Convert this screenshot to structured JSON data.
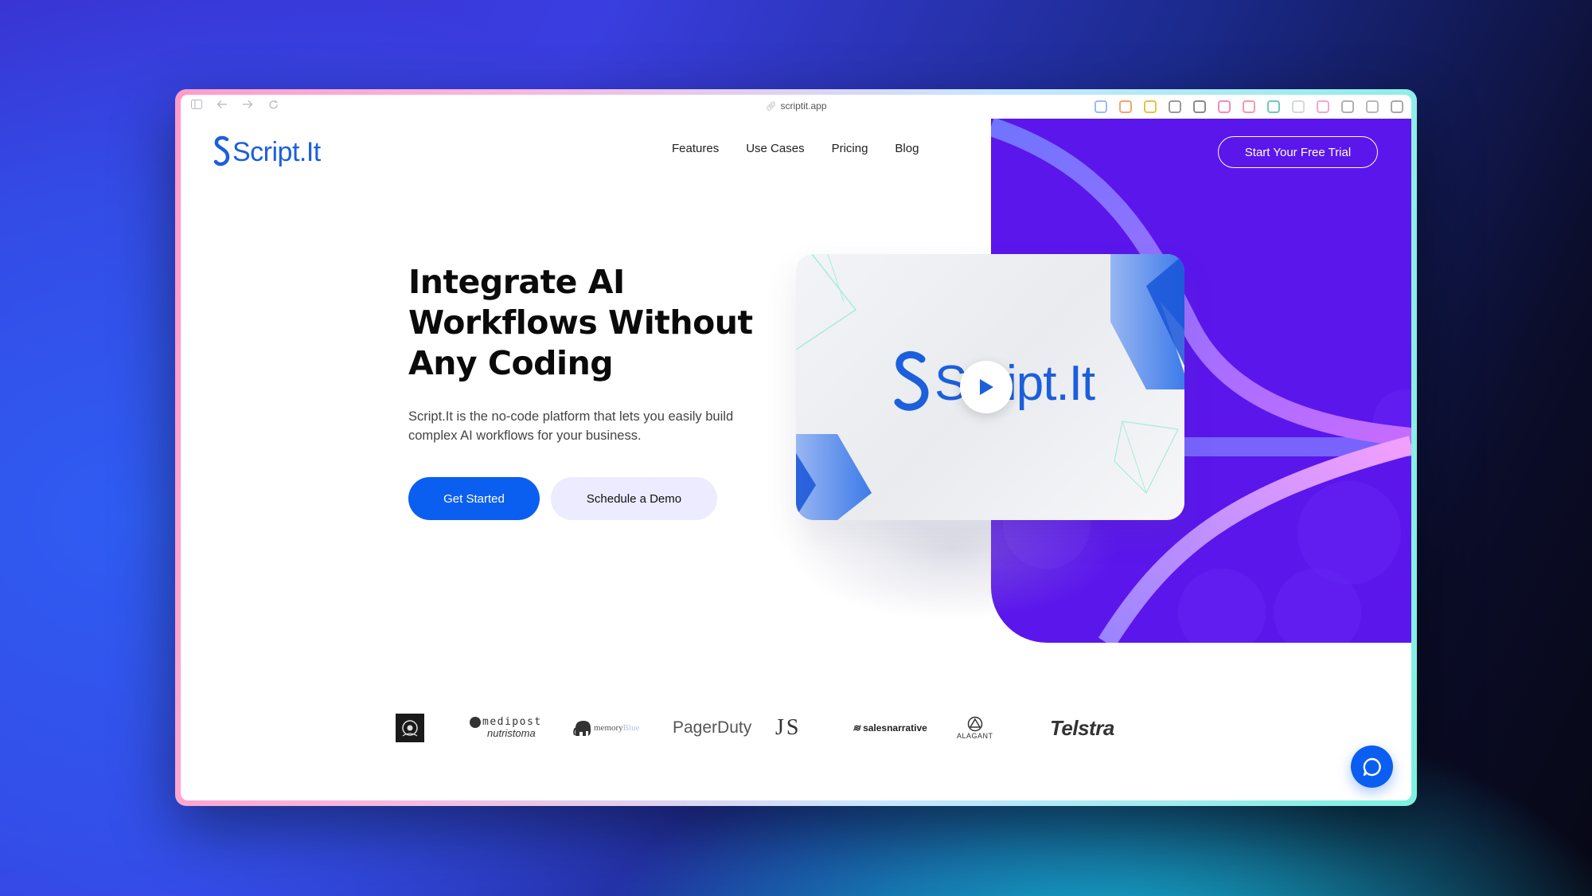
{
  "browser": {
    "url": "scriptit.app",
    "left_icons": [
      "sidebar-toggle-icon",
      "back-arrow-icon",
      "forward-arrow-icon",
      "reload-icon"
    ],
    "extension_colors": [
      "#9fb9f5",
      "#f5a56b",
      "#e2c24a",
      "#9a9a9a",
      "#8a8a8a",
      "#f28db5",
      "#f49aa8",
      "#6fc9c0",
      "#d8d8d8",
      "#f1a6cf",
      "#b0b0b0",
      "#b8b8b8",
      "#a8a8a8"
    ]
  },
  "site": {
    "logo": "Script.It",
    "nav": [
      "Features",
      "Use Cases",
      "Pricing",
      "Blog"
    ],
    "cta_top": "Start Your Free Trial"
  },
  "hero": {
    "title": "Integrate AI Workflows Without Any Coding",
    "subtitle": "Script.It is the no-code platform that lets you easily build complex AI workflows for your business.",
    "primary_button": "Get Started",
    "secondary_button": "Schedule a Demo"
  },
  "video": {
    "logo": "Script.It"
  },
  "brands": {
    "medipost_top": "medipost",
    "medipost_bottom": "nutristoma",
    "memoryblue_a": "memory",
    "memoryblue_b": "Blue",
    "pagerduty": "PagerDuty",
    "js": "J S",
    "salesnarrative": "salesnarrative",
    "alagant": "ALAGANT",
    "telstra": "Telstra"
  },
  "colors": {
    "brand_blue": "#0b5ff0",
    "logo_blue": "#1c5fdc",
    "panel_purple": "#5b16ec",
    "secondary_button_bg": "#ecebff"
  }
}
